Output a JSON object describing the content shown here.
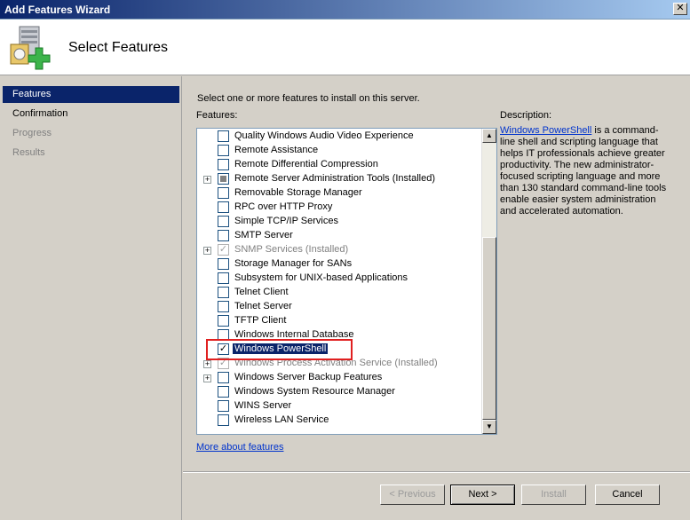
{
  "window": {
    "title": "Add Features Wizard",
    "close_glyph": "✕"
  },
  "header": {
    "title": "Select Features",
    "icon": "server-add-icon"
  },
  "nav": {
    "items": [
      {
        "label": "Features",
        "state": "active"
      },
      {
        "label": "Confirmation",
        "state": "normal"
      },
      {
        "label": "Progress",
        "state": "disabled"
      },
      {
        "label": "Results",
        "state": "disabled"
      }
    ]
  },
  "main": {
    "instruction": "Select one or more features to install on this server.",
    "features_label": "Features:",
    "description_label": "Description:",
    "description_link": "Windows PowerShell",
    "description_text": " is a command-line shell and scripting language that helps IT professionals achieve greater productivity. The new administrator-focused scripting language and more than 130 standard command-line tools enable easier system administration and accelerated automation.",
    "more_link": "More about features"
  },
  "features": [
    {
      "label": "Quality Windows Audio Video Experience",
      "expander": false,
      "check": "none",
      "grey": false
    },
    {
      "label": "Remote Assistance",
      "expander": false,
      "check": "none",
      "grey": false
    },
    {
      "label": "Remote Differential Compression",
      "expander": false,
      "check": "none",
      "grey": false
    },
    {
      "label": "Remote Server Administration Tools  (Installed)",
      "expander": true,
      "check": "partial",
      "grey": false
    },
    {
      "label": "Removable Storage Manager",
      "expander": false,
      "check": "none",
      "grey": false
    },
    {
      "label": "RPC over HTTP Proxy",
      "expander": false,
      "check": "none",
      "grey": false
    },
    {
      "label": "Simple TCP/IP Services",
      "expander": false,
      "check": "none",
      "grey": false
    },
    {
      "label": "SMTP Server",
      "expander": false,
      "check": "none",
      "grey": false
    },
    {
      "label": "SNMP Services  (Installed)",
      "expander": true,
      "check": "grey-check",
      "grey": true
    },
    {
      "label": "Storage Manager for SANs",
      "expander": false,
      "check": "none",
      "grey": false
    },
    {
      "label": "Subsystem for UNIX-based Applications",
      "expander": false,
      "check": "none",
      "grey": false
    },
    {
      "label": "Telnet Client",
      "expander": false,
      "check": "none",
      "grey": false
    },
    {
      "label": "Telnet Server",
      "expander": false,
      "check": "none",
      "grey": false
    },
    {
      "label": "TFTP Client",
      "expander": false,
      "check": "none",
      "grey": false
    },
    {
      "label": "Windows Internal Database",
      "expander": false,
      "check": "none",
      "grey": false
    },
    {
      "label": "Windows PowerShell",
      "expander": false,
      "check": "checked",
      "grey": false,
      "selected": true
    },
    {
      "label": "Windows Process Activation Service  (Installed)",
      "expander": true,
      "check": "grey-check",
      "grey": true
    },
    {
      "label": "Windows Server Backup Features",
      "expander": true,
      "check": "none",
      "grey": false
    },
    {
      "label": "Windows System Resource Manager",
      "expander": false,
      "check": "none",
      "grey": false
    },
    {
      "label": "WINS Server",
      "expander": false,
      "check": "none",
      "grey": false
    },
    {
      "label": "Wireless LAN Service",
      "expander": false,
      "check": "none",
      "grey": false
    }
  ],
  "buttons": {
    "previous": "< Previous",
    "next": "Next >",
    "install": "Install",
    "cancel": "Cancel"
  },
  "colors": {
    "selection": "#0a246a",
    "link": "#0033cc",
    "highlight_box": "#e02020"
  }
}
